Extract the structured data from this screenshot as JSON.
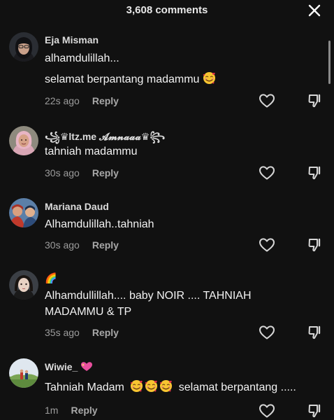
{
  "header": {
    "title": "3,608 comments"
  },
  "comments": [
    {
      "user": "Eja Misman",
      "lines": [
        "alhamdulillah...",
        "selamat berpantang madammu"
      ],
      "time": "22s ago",
      "reply": "Reply"
    },
    {
      "user": "꧁♛ltz.me 𝓐𝓶𝓷𝓪𝓪𝓪♛꧂",
      "lines": [
        "tahniah madammu"
      ],
      "time": "30s ago",
      "reply": "Reply"
    },
    {
      "user": "Mariana Daud",
      "lines": [
        "Alhamdulillah..tahniah"
      ],
      "time": "30s ago",
      "reply": "Reply"
    },
    {
      "user": "🌈",
      "lines": [
        "Alhamdullillah.... baby NOIR .... TAHNIAH",
        "MADAMMU & TP"
      ],
      "time": "35s ago",
      "reply": "Reply"
    },
    {
      "user": "Wiwie_",
      "lines": [
        "Tahniah Madam",
        "selamat berpantang ....."
      ],
      "time": "1m",
      "reply": "Reply"
    }
  ],
  "icons": {
    "close": "close-icon",
    "like": "heart-outline-icon",
    "dislike": "thumbs-down-icon",
    "emoji": "smiling-face-with-hearts-emoji"
  },
  "colors": {
    "background": "#111111",
    "text": "#f2f2f2",
    "muted": "#9c9c9c"
  }
}
